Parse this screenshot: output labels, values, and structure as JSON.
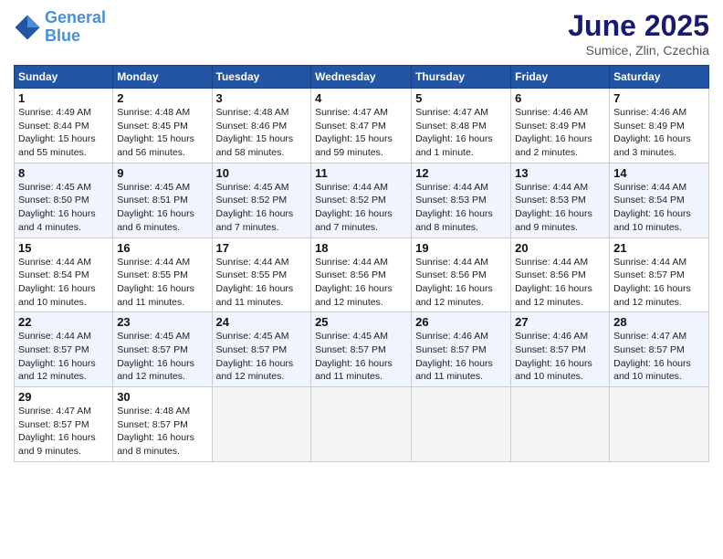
{
  "header": {
    "logo_line1": "General",
    "logo_line2": "Blue",
    "title": "June 2025",
    "subtitle": "Sumice, Zlin, Czechia"
  },
  "days_of_week": [
    "Sunday",
    "Monday",
    "Tuesday",
    "Wednesday",
    "Thursday",
    "Friday",
    "Saturday"
  ],
  "weeks": [
    [
      {
        "day": "1",
        "info": "Sunrise: 4:49 AM\nSunset: 8:44 PM\nDaylight: 15 hours\nand 55 minutes."
      },
      {
        "day": "2",
        "info": "Sunrise: 4:48 AM\nSunset: 8:45 PM\nDaylight: 15 hours\nand 56 minutes."
      },
      {
        "day": "3",
        "info": "Sunrise: 4:48 AM\nSunset: 8:46 PM\nDaylight: 15 hours\nand 58 minutes."
      },
      {
        "day": "4",
        "info": "Sunrise: 4:47 AM\nSunset: 8:47 PM\nDaylight: 15 hours\nand 59 minutes."
      },
      {
        "day": "5",
        "info": "Sunrise: 4:47 AM\nSunset: 8:48 PM\nDaylight: 16 hours\nand 1 minute."
      },
      {
        "day": "6",
        "info": "Sunrise: 4:46 AM\nSunset: 8:49 PM\nDaylight: 16 hours\nand 2 minutes."
      },
      {
        "day": "7",
        "info": "Sunrise: 4:46 AM\nSunset: 8:49 PM\nDaylight: 16 hours\nand 3 minutes."
      }
    ],
    [
      {
        "day": "8",
        "info": "Sunrise: 4:45 AM\nSunset: 8:50 PM\nDaylight: 16 hours\nand 4 minutes."
      },
      {
        "day": "9",
        "info": "Sunrise: 4:45 AM\nSunset: 8:51 PM\nDaylight: 16 hours\nand 6 minutes."
      },
      {
        "day": "10",
        "info": "Sunrise: 4:45 AM\nSunset: 8:52 PM\nDaylight: 16 hours\nand 7 minutes."
      },
      {
        "day": "11",
        "info": "Sunrise: 4:44 AM\nSunset: 8:52 PM\nDaylight: 16 hours\nand 7 minutes."
      },
      {
        "day": "12",
        "info": "Sunrise: 4:44 AM\nSunset: 8:53 PM\nDaylight: 16 hours\nand 8 minutes."
      },
      {
        "day": "13",
        "info": "Sunrise: 4:44 AM\nSunset: 8:53 PM\nDaylight: 16 hours\nand 9 minutes."
      },
      {
        "day": "14",
        "info": "Sunrise: 4:44 AM\nSunset: 8:54 PM\nDaylight: 16 hours\nand 10 minutes."
      }
    ],
    [
      {
        "day": "15",
        "info": "Sunrise: 4:44 AM\nSunset: 8:54 PM\nDaylight: 16 hours\nand 10 minutes."
      },
      {
        "day": "16",
        "info": "Sunrise: 4:44 AM\nSunset: 8:55 PM\nDaylight: 16 hours\nand 11 minutes."
      },
      {
        "day": "17",
        "info": "Sunrise: 4:44 AM\nSunset: 8:55 PM\nDaylight: 16 hours\nand 11 minutes."
      },
      {
        "day": "18",
        "info": "Sunrise: 4:44 AM\nSunset: 8:56 PM\nDaylight: 16 hours\nand 12 minutes."
      },
      {
        "day": "19",
        "info": "Sunrise: 4:44 AM\nSunset: 8:56 PM\nDaylight: 16 hours\nand 12 minutes."
      },
      {
        "day": "20",
        "info": "Sunrise: 4:44 AM\nSunset: 8:56 PM\nDaylight: 16 hours\nand 12 minutes."
      },
      {
        "day": "21",
        "info": "Sunrise: 4:44 AM\nSunset: 8:57 PM\nDaylight: 16 hours\nand 12 minutes."
      }
    ],
    [
      {
        "day": "22",
        "info": "Sunrise: 4:44 AM\nSunset: 8:57 PM\nDaylight: 16 hours\nand 12 minutes."
      },
      {
        "day": "23",
        "info": "Sunrise: 4:45 AM\nSunset: 8:57 PM\nDaylight: 16 hours\nand 12 minutes."
      },
      {
        "day": "24",
        "info": "Sunrise: 4:45 AM\nSunset: 8:57 PM\nDaylight: 16 hours\nand 12 minutes."
      },
      {
        "day": "25",
        "info": "Sunrise: 4:45 AM\nSunset: 8:57 PM\nDaylight: 16 hours\nand 11 minutes."
      },
      {
        "day": "26",
        "info": "Sunrise: 4:46 AM\nSunset: 8:57 PM\nDaylight: 16 hours\nand 11 minutes."
      },
      {
        "day": "27",
        "info": "Sunrise: 4:46 AM\nSunset: 8:57 PM\nDaylight: 16 hours\nand 10 minutes."
      },
      {
        "day": "28",
        "info": "Sunrise: 4:47 AM\nSunset: 8:57 PM\nDaylight: 16 hours\nand 10 minutes."
      }
    ],
    [
      {
        "day": "29",
        "info": "Sunrise: 4:47 AM\nSunset: 8:57 PM\nDaylight: 16 hours\nand 9 minutes."
      },
      {
        "day": "30",
        "info": "Sunrise: 4:48 AM\nSunset: 8:57 PM\nDaylight: 16 hours\nand 8 minutes."
      },
      {
        "day": "",
        "info": ""
      },
      {
        "day": "",
        "info": ""
      },
      {
        "day": "",
        "info": ""
      },
      {
        "day": "",
        "info": ""
      },
      {
        "day": "",
        "info": ""
      }
    ]
  ]
}
